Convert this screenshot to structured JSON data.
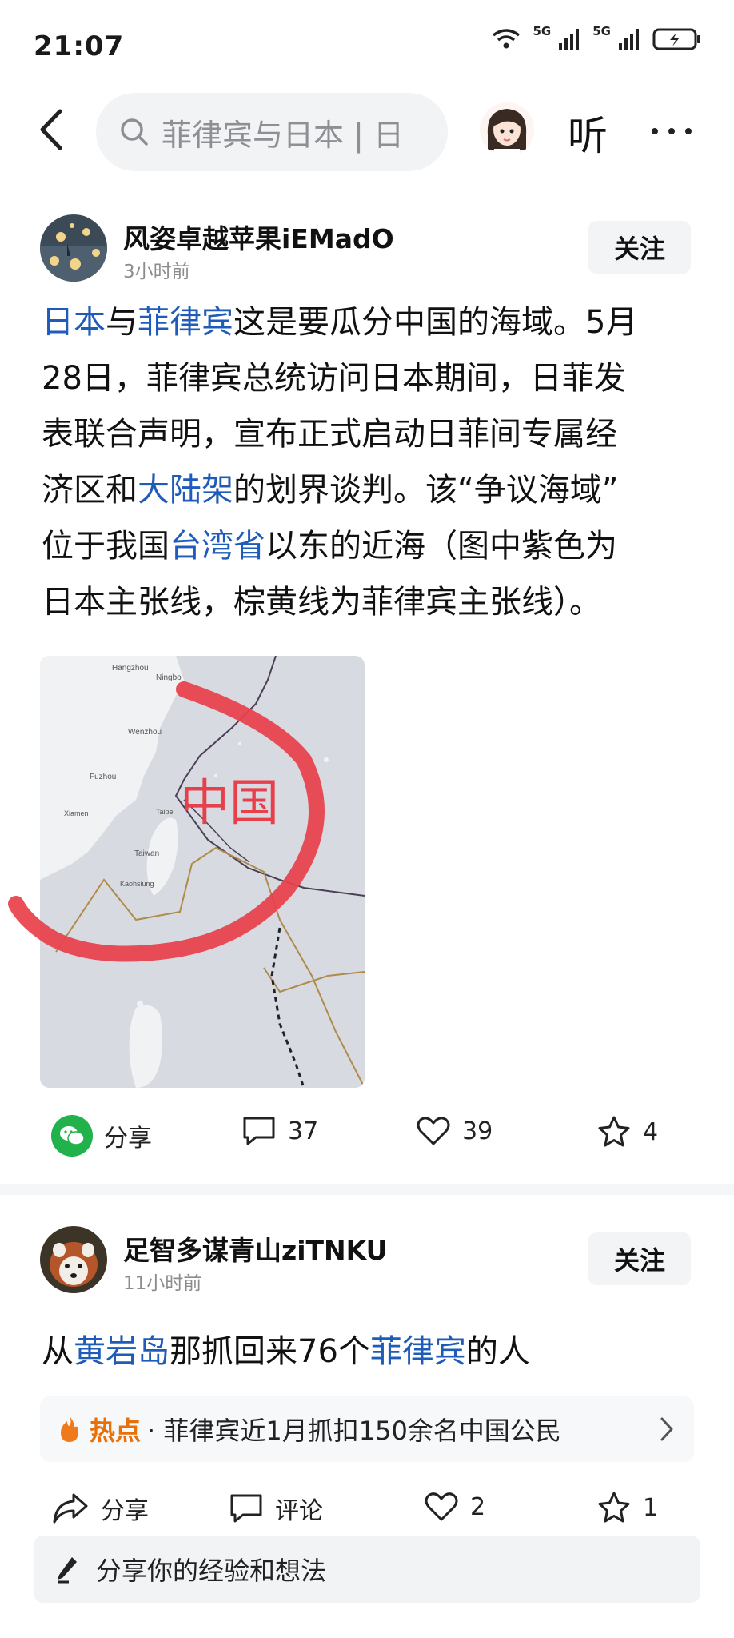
{
  "status_bar": {
    "time": "21:07",
    "network_1": "5G",
    "network_2": "5G"
  },
  "top_bar": {
    "search_text": "菲律宾与日本 | 日",
    "listen_label": "听"
  },
  "post1": {
    "author": "风姿卓越苹果iEMadO",
    "time": "3小时前",
    "follow_label": "关注",
    "text_lines": [
      [
        "日本",
        "与",
        "菲律宾",
        "这是要瓜分中国的海域。5月"
      ],
      [
        "28日，菲律宾总统访问日本期间，日菲发"
      ],
      [
        "表联合声明，宣布正式启动日菲间专属经"
      ],
      [
        "济区和",
        "大陆架",
        "的划界谈判。该“争议海域”"
      ],
      [
        "位于我国",
        "台湾省",
        "以东的近海（图中紫色为"
      ],
      [
        "日本主张线，棕黄线为菲律宾主张线）。"
      ]
    ],
    "map": {
      "overlay_label": "中国",
      "place_labels": [
        "Hangzhou",
        "Ningbo",
        "Wenzhou",
        "Fuzhou",
        "Taipei",
        "Taiwan",
        "Xiamen",
        "Kaohsiung"
      ]
    },
    "share_label": "分享",
    "comments": "37",
    "likes": "39",
    "favorites": "4"
  },
  "post2": {
    "author": "足智多谋青山ziTNKU",
    "time": "11小时前",
    "follow_label": "关注",
    "text_parts": [
      "从",
      "黄岩岛",
      "那抓回来76个",
      "菲律宾",
      "的人"
    ],
    "hot_label": "热点",
    "hot_text": "· 菲律宾近1月抓扣150余名中国公民",
    "share_label": "分享",
    "comment_label": "评论",
    "likes": "2",
    "favorites": "1"
  },
  "comment_input": {
    "placeholder": "分享你的经验和想法"
  },
  "colors": {
    "link": "#1f5bb8",
    "hot": "#e8700a",
    "wechat": "#21b24b",
    "overlay_red": "#e8404a"
  }
}
